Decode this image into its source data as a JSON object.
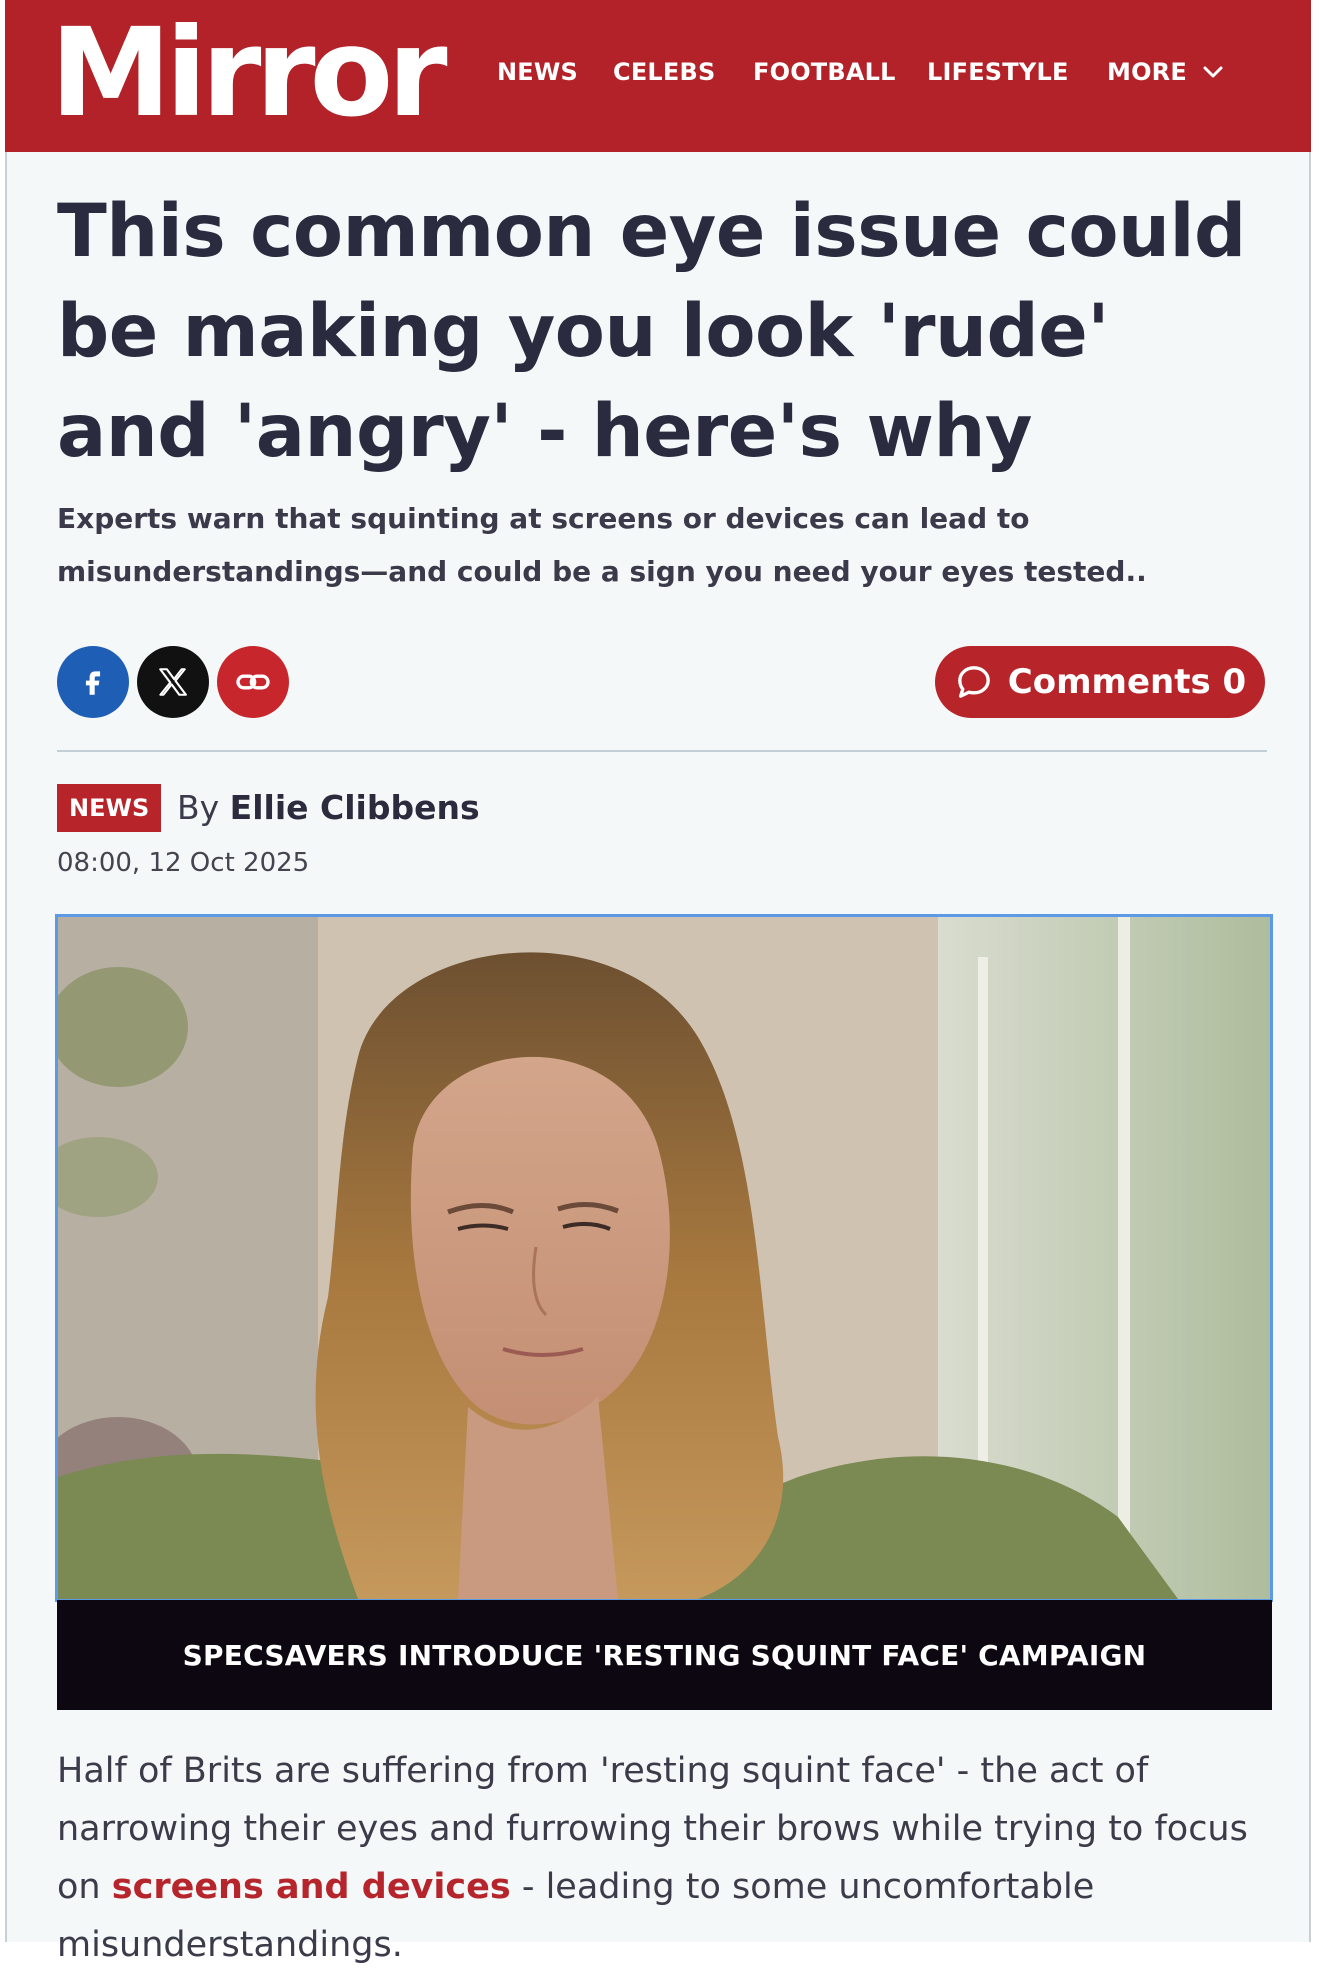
{
  "header": {
    "logo": "Mirror",
    "nav": [
      {
        "label": "NEWS"
      },
      {
        "label": "CELEBS"
      },
      {
        "label": "FOOTBALL"
      },
      {
        "label": "LIFESTYLE"
      },
      {
        "label": "MORE"
      }
    ]
  },
  "article": {
    "headline": "This common eye issue could be making you look 'rude' and 'angry' - here's why",
    "standfirst": "Experts warn that squinting at screens or devices can lead to misunderstandings—and could be a sign you need your eyes tested..",
    "comments_label": "Comments 0",
    "tag": "NEWS",
    "by": "By",
    "author": "Ellie Clibbens",
    "date": "08:00, 12 Oct 2025",
    "media_caption": "SPECSAVERS INTRODUCE 'RESTING SQUINT FACE' CAMPAIGN",
    "para": {
      "before": "Half of Brits are suffering from 'resting squint face' - the act of narrowing their eyes and furrowing their brows while trying to focus on ",
      "link": "screens and devices",
      "after": " - leading to some uncomfortable misunderstandings."
    }
  },
  "colors": {
    "brand_red": "#b22228",
    "link_red": "#b5252b",
    "facebook_blue": "#1e5fb5",
    "x_black": "#111111"
  },
  "icons": {
    "facebook": "facebook-icon",
    "x": "x-icon",
    "link": "link-icon",
    "comment": "speech-bubble-icon",
    "more": "chevron-down-icon"
  }
}
